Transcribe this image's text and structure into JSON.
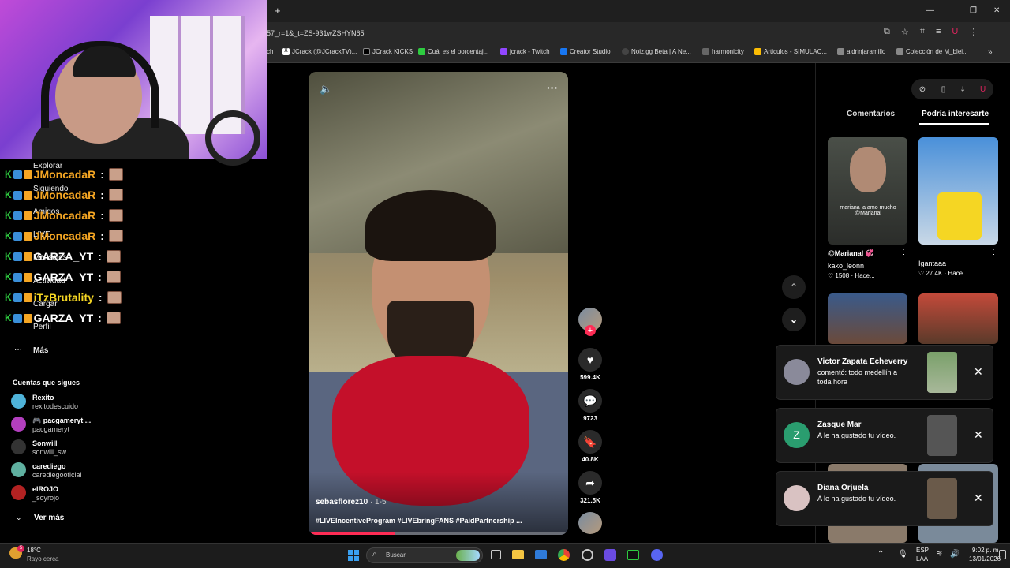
{
  "browser": {
    "tab_add": "+",
    "url": "57_r=1&_t=ZS-931wZSHYN65",
    "bookmarks": [
      "ch",
      "JCrack (@JCrackTV)...",
      "JCrack KICKS",
      "Cuál es el porcentaj...",
      "jcrack - Twitch",
      "Creator Studio",
      "Noiz.gg Beta | A Ne...",
      "harmonicity",
      "Articulos - SIMULAC...",
      "aldrinjaramillo",
      "Colección de M_blei..."
    ],
    "bookmark_more": "»"
  },
  "sidebar": {
    "nav": [
      "Explorar",
      "Siguiendo",
      "Amigos",
      "LIVE",
      "Mensajes",
      "Actividad",
      "Cargar",
      "Perfil",
      "Más"
    ],
    "following_title": "Cuentas que sigues",
    "accounts": [
      {
        "name": "Rexito",
        "user": "rexitodescuido",
        "color": "#4fb3d9"
      },
      {
        "name": "🎮 pacgameryt ...",
        "user": "pacgameryt",
        "color": "#b33fbf"
      },
      {
        "name": "Sonwill",
        "user": "sonwill_sw",
        "color": "#333333"
      },
      {
        "name": "carediego",
        "user": "carediegooficial",
        "color": "#5fb0a0"
      },
      {
        "name": "elROJO",
        "user": "_soyrojo",
        "color": "#b22222"
      }
    ],
    "see_more": "Ver más"
  },
  "chat": [
    {
      "user": "JMoncadaR",
      "sep": ":",
      "color": "#f5a623"
    },
    {
      "user": "JMoncadaR",
      "sep": ":",
      "color": "#f5a623"
    },
    {
      "user": "JMoncadaR",
      "sep": ":",
      "color": "#f5a623"
    },
    {
      "user": "JMoncadaR",
      "sep": ":",
      "color": "#f5a623"
    },
    {
      "user": "GARZA_YT",
      "sep": ":",
      "color": "#ffffff"
    },
    {
      "user": "GARZA_YT",
      "sep": ":",
      "color": "#ffffff"
    },
    {
      "user": "iTzBrutality",
      "sep": ":",
      "color": "#f5d623"
    },
    {
      "user": "GARZA_YT",
      "sep": ":",
      "color": "#ffffff"
    }
  ],
  "video": {
    "author": "sebasflorez10",
    "date": "· 1-5",
    "caption": "#LIVEIncentiveProgram #LIVEbringFANS #PaidPartnership ...",
    "progress": 0.33,
    "likes": "599.4K",
    "comments": "9723",
    "saves": "40.8K",
    "shares": "321.5K"
  },
  "right_panel": {
    "tabs": [
      "Comentarios",
      "Podría interesarte"
    ],
    "cards": [
      {
        "caption": "mariana la amo mucho @Marianal",
        "mention": "@Marianal 💞",
        "user": "kako_leonn",
        "likes": "♡ 1508",
        "time": "· Hace..."
      },
      {
        "user": "Igantaaa",
        "likes": "♡ 27.4K",
        "time": "· Hace..."
      }
    ]
  },
  "notifications": [
    {
      "name": "Victor Zapata Echeverry",
      "msg": "comentó: todo medellín a toda hora",
      "color": "#8a8a9a"
    },
    {
      "name": "Zasque Mar",
      "msg": "A le ha gustado tu vídeo.",
      "initial": "Z",
      "color": "#2a9d6f"
    },
    {
      "name": "Diana Orjuela",
      "msg": "A le ha gustado tu vídeo.",
      "color": "#d9c2c2"
    }
  ],
  "taskbar": {
    "weather_temp": "18°C",
    "weather_desc": "Rayo cerca",
    "search": "Buscar",
    "lang": "ESP",
    "lang2": "LAA",
    "time": "9:02 p. m.",
    "date": "13/01/2026",
    "badge": "5"
  },
  "colors": {
    "accent": "#fe2c55",
    "chat_green": "#2ecc40"
  }
}
